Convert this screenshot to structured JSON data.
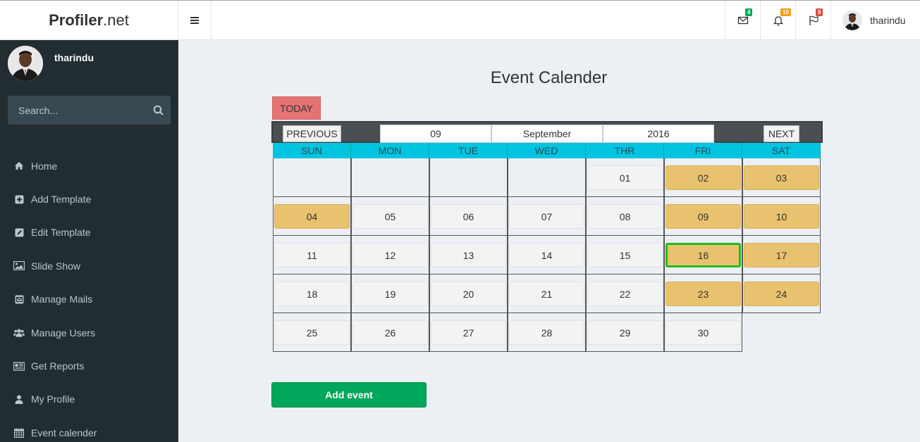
{
  "app": {
    "brand_bold": "Profiler",
    "brand_rest": ".net"
  },
  "header": {
    "mail_count": "4",
    "notif_count": "10",
    "flag_count": "9",
    "username": "tharindu",
    "colors": {
      "mail_badge": "#00a65a",
      "notif_badge": "#f39c12",
      "flag_badge": "#dd4b39"
    }
  },
  "sidebar": {
    "username": "tharindu",
    "search_placeholder": "Search...",
    "items": [
      {
        "label": "Home",
        "icon": "home-icon"
      },
      {
        "label": "Add Template",
        "icon": "plus-square-icon"
      },
      {
        "label": "Edit Template",
        "icon": "edit-icon"
      },
      {
        "label": "Slide Show",
        "icon": "image-icon"
      },
      {
        "label": "Manage Mails",
        "icon": "envelope-icon"
      },
      {
        "label": "Manage Users",
        "icon": "users-icon"
      },
      {
        "label": "Get Reports",
        "icon": "newspaper-icon"
      },
      {
        "label": "My Profile",
        "icon": "user-icon"
      },
      {
        "label": "Event calender",
        "icon": "calendar-icon"
      }
    ]
  },
  "main": {
    "title": "Event Calender",
    "today_label": "TODAY",
    "prev_label": "PREVIOUS",
    "next_label": "NEXT",
    "month_num": "09",
    "month_name": "September",
    "year": "2016",
    "add_event_label": "Add event",
    "day_headers": [
      "SUN",
      "MON",
      "TUE",
      "WED",
      "THR",
      "FRI",
      "SAT"
    ],
    "weeks": [
      [
        "",
        "",
        "",
        "",
        "01",
        "02",
        "03"
      ],
      [
        "04",
        "05",
        "06",
        "07",
        "08",
        "09",
        "10"
      ],
      [
        "11",
        "12",
        "13",
        "14",
        "15",
        "16",
        "17"
      ],
      [
        "18",
        "19",
        "20",
        "21",
        "22",
        "23",
        "24"
      ],
      [
        "25",
        "26",
        "27",
        "28",
        "29",
        "30"
      ]
    ],
    "event_days": [
      "02",
      "03",
      "04",
      "09",
      "10",
      "16",
      "17",
      "23",
      "24"
    ],
    "today_day": "16",
    "colors": {
      "today_button": "#e57373",
      "day_header": "#00c4e0",
      "event_day": "#e8c26e",
      "today_border": "#22bb22",
      "add_button": "#00a65a"
    }
  }
}
